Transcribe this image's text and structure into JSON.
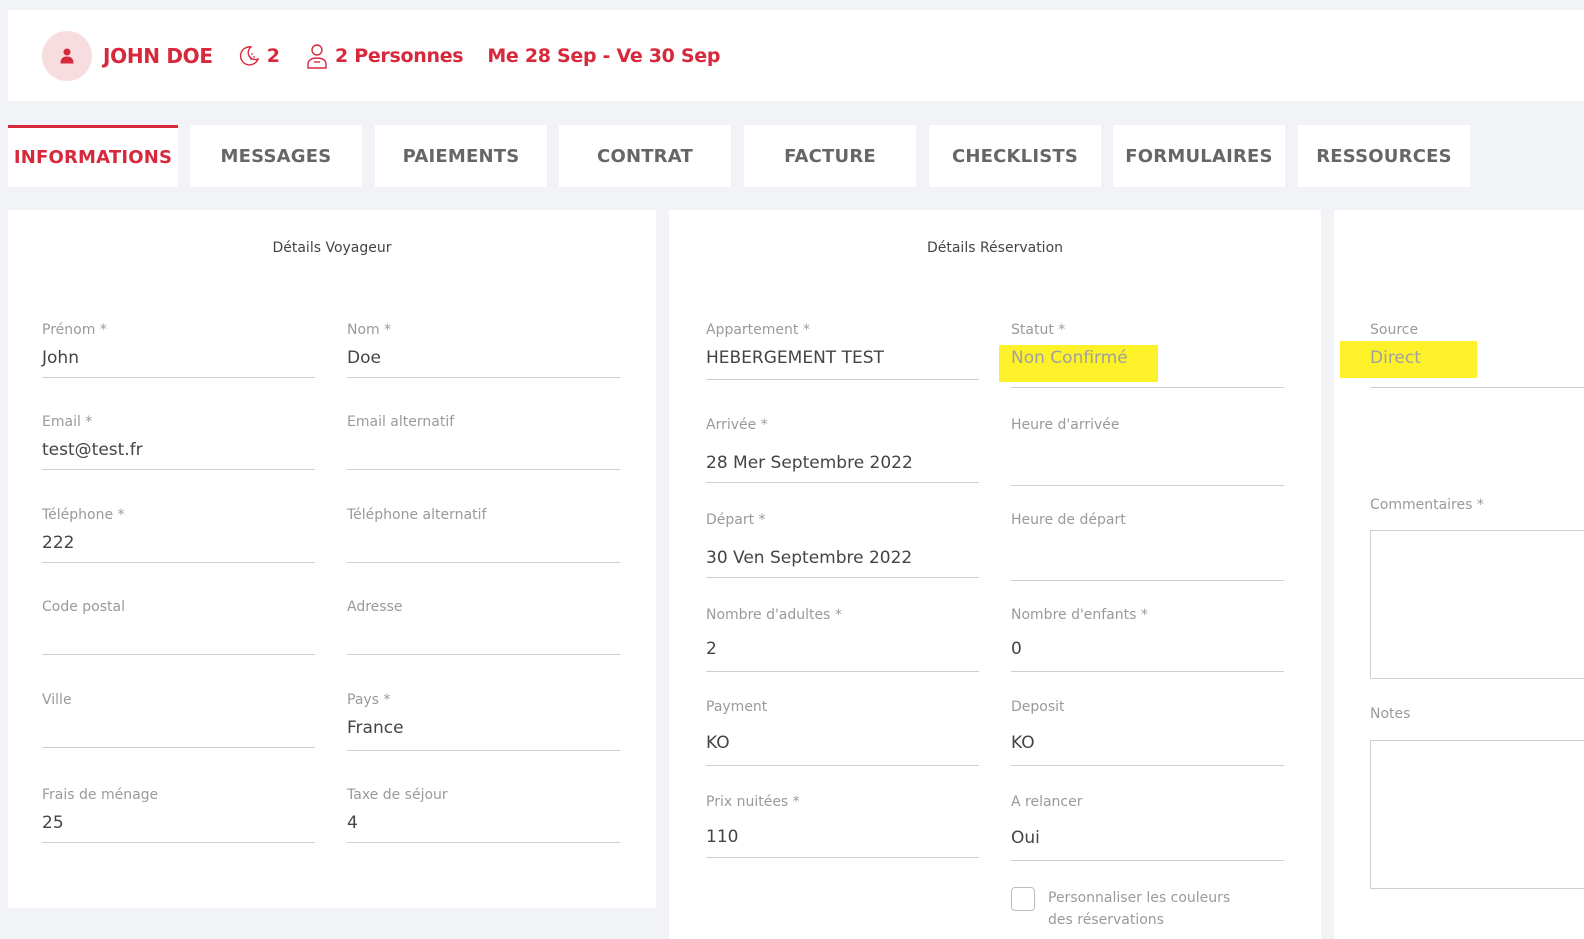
{
  "header": {
    "guest_name": "JOHN DOE",
    "nights": "2",
    "persons": "2 Personnes",
    "dates": "Me 28 Sep - Ve 30 Sep"
  },
  "tabs": [
    {
      "label": "INFORMATIONS",
      "active": true
    },
    {
      "label": "MESSAGES"
    },
    {
      "label": "PAIEMENTS"
    },
    {
      "label": "CONTRAT"
    },
    {
      "label": "FACTURE"
    },
    {
      "label": "CHECKLISTS"
    },
    {
      "label": "FORMULAIRES"
    },
    {
      "label": "RESSOURCES"
    }
  ],
  "voyageur": {
    "title": "Détails Voyageur",
    "prenom": {
      "label": "Prénom *",
      "value": "John"
    },
    "nom": {
      "label": "Nom *",
      "value": "Doe"
    },
    "email": {
      "label": "Email *",
      "value": "test@test.fr"
    },
    "email_alt": {
      "label": "Email alternatif",
      "value": ""
    },
    "telephone": {
      "label": "Téléphone *",
      "value": "222"
    },
    "telephone_alt": {
      "label": "Téléphone alternatif",
      "value": ""
    },
    "code_postal": {
      "label": "Code postal",
      "value": ""
    },
    "adresse": {
      "label": "Adresse",
      "value": ""
    },
    "ville": {
      "label": "Ville",
      "value": ""
    },
    "pays": {
      "label": "Pays *",
      "value": "France"
    },
    "frais_menage": {
      "label": "Frais de ménage",
      "value": "25"
    },
    "taxe_sejour": {
      "label": "Taxe de séjour",
      "value": "4"
    }
  },
  "reservation": {
    "title": "Détails Réservation",
    "appartement": {
      "label": "Appartement *",
      "value": "HEBERGEMENT TEST"
    },
    "statut": {
      "label": "Statut *",
      "value": "Non Confirmé"
    },
    "arrivee": {
      "label": "Arrivée *",
      "value": "28 Mer Septembre 2022"
    },
    "heure_arrivee": {
      "label": "Heure d'arrivée",
      "value": ""
    },
    "depart": {
      "label": "Départ *",
      "value": "30 Ven Septembre 2022"
    },
    "heure_depart": {
      "label": "Heure de départ",
      "value": ""
    },
    "adultes": {
      "label": "Nombre d'adultes *",
      "value": "2"
    },
    "enfants": {
      "label": "Nombre d'enfants *",
      "value": "0"
    },
    "payment": {
      "label": "Payment",
      "value": "KO"
    },
    "deposit": {
      "label": "Deposit",
      "value": "KO"
    },
    "prix_nuitees": {
      "label": "Prix nuitées *",
      "value": "110"
    },
    "a_relancer": {
      "label": "A relancer",
      "value": "Oui"
    },
    "personnaliser": {
      "label": "Personnaliser les couleurs des réservations",
      "checked": false
    }
  },
  "extra": {
    "source": {
      "label": "Source",
      "value": "Direct"
    },
    "commentaires": {
      "label": "Commentaires *",
      "value": ""
    },
    "notes": {
      "label": "Notes",
      "value": ""
    }
  },
  "colors": {
    "accent": "#d7283c",
    "highlight": "#fdf22a",
    "background": "#f1f3f6"
  }
}
